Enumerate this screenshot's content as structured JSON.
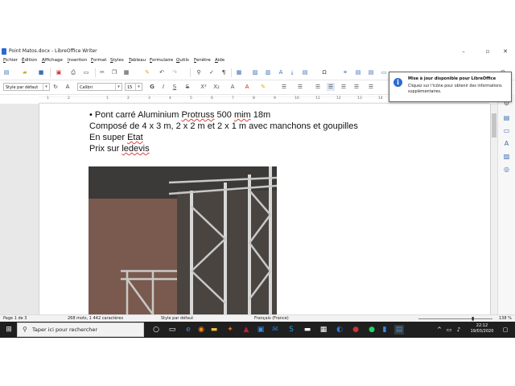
{
  "window": {
    "title": "Point Matos.docx - LibreOffice Writer",
    "controls": {
      "minimize": "–",
      "maximize": "▫",
      "close": "✕"
    }
  },
  "menubar": [
    "Fichier",
    "Édition",
    "Affichage",
    "Insertion",
    "Format",
    "Styles",
    "Tableau",
    "Formulaire",
    "Outils",
    "Fenêtre",
    "Aide"
  ],
  "formatting": {
    "paragraph_style": "Style par défaut",
    "font_name": "Calibri",
    "font_size": "15"
  },
  "ruler": {
    "numbers": [
      "1",
      "2",
      "1",
      "2",
      "3",
      "4",
      "5",
      "6",
      "7",
      "8",
      "9",
      "10",
      "11",
      "12",
      "13",
      "14",
      "15",
      "16",
      "17",
      "18"
    ]
  },
  "document": {
    "line1": {
      "prefix": "• Pont carré Aluminium ",
      "word": "Protruss",
      "middle": " 500 ",
      "word2": "mim",
      "suffix": " 18m"
    },
    "line2": "Composé de 4 x 3 m, 2 x 2 m et 2 x 1 m avec manchons et goupilles",
    "line3": {
      "prefix": "En super ",
      "word": "Etat"
    },
    "line4": {
      "prefix": "Prix sur ",
      "word": "ledevis"
    }
  },
  "notification": {
    "title": "Mise à jour disponible pour LibreOffice",
    "body": "Cliquez sur l'icône pour obtenir des informations supplémentaires."
  },
  "statusbar": {
    "page": "Page 1 de 3",
    "words": "268 mots, 1 442 caractères",
    "style": "Style par défaut",
    "language": "Français (France)",
    "zoom": "138 %"
  },
  "taskbar": {
    "search_placeholder": "Taper ici pour rechercher",
    "time": "22:12",
    "date": "19/03/2020"
  },
  "colors": {
    "accent": "#2a6ad1",
    "taskbar": "#1f1f1f"
  }
}
